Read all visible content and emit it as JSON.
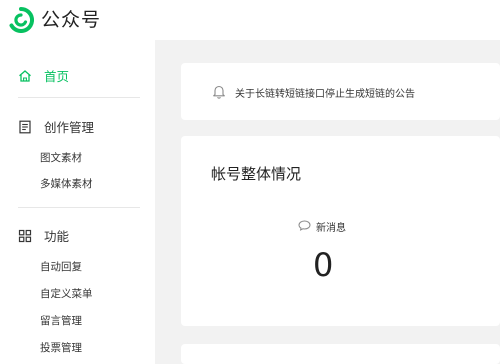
{
  "header": {
    "title": "公众号",
    "logo_icon": "wechat-mp-logo-icon",
    "brand_color": "#07c160"
  },
  "sidebar": {
    "home": {
      "label": "首页",
      "icon": "home-icon"
    },
    "creation": {
      "label": "创作管理",
      "icon": "document-icon",
      "items": [
        "图文素材",
        "多媒体素材"
      ]
    },
    "features": {
      "label": "功能",
      "icon": "grid-icon",
      "items": [
        "自动回复",
        "自定义菜单",
        "留言管理",
        "投票管理"
      ]
    }
  },
  "notice": {
    "icon": "bell-icon",
    "text": "关于长链转短链接口停止生成短链的公告"
  },
  "account_overview": {
    "title": "帐号整体情况",
    "new_messages_label": "新消息",
    "new_messages_icon": "chat-bubble-icon",
    "new_messages_count": "0"
  }
}
